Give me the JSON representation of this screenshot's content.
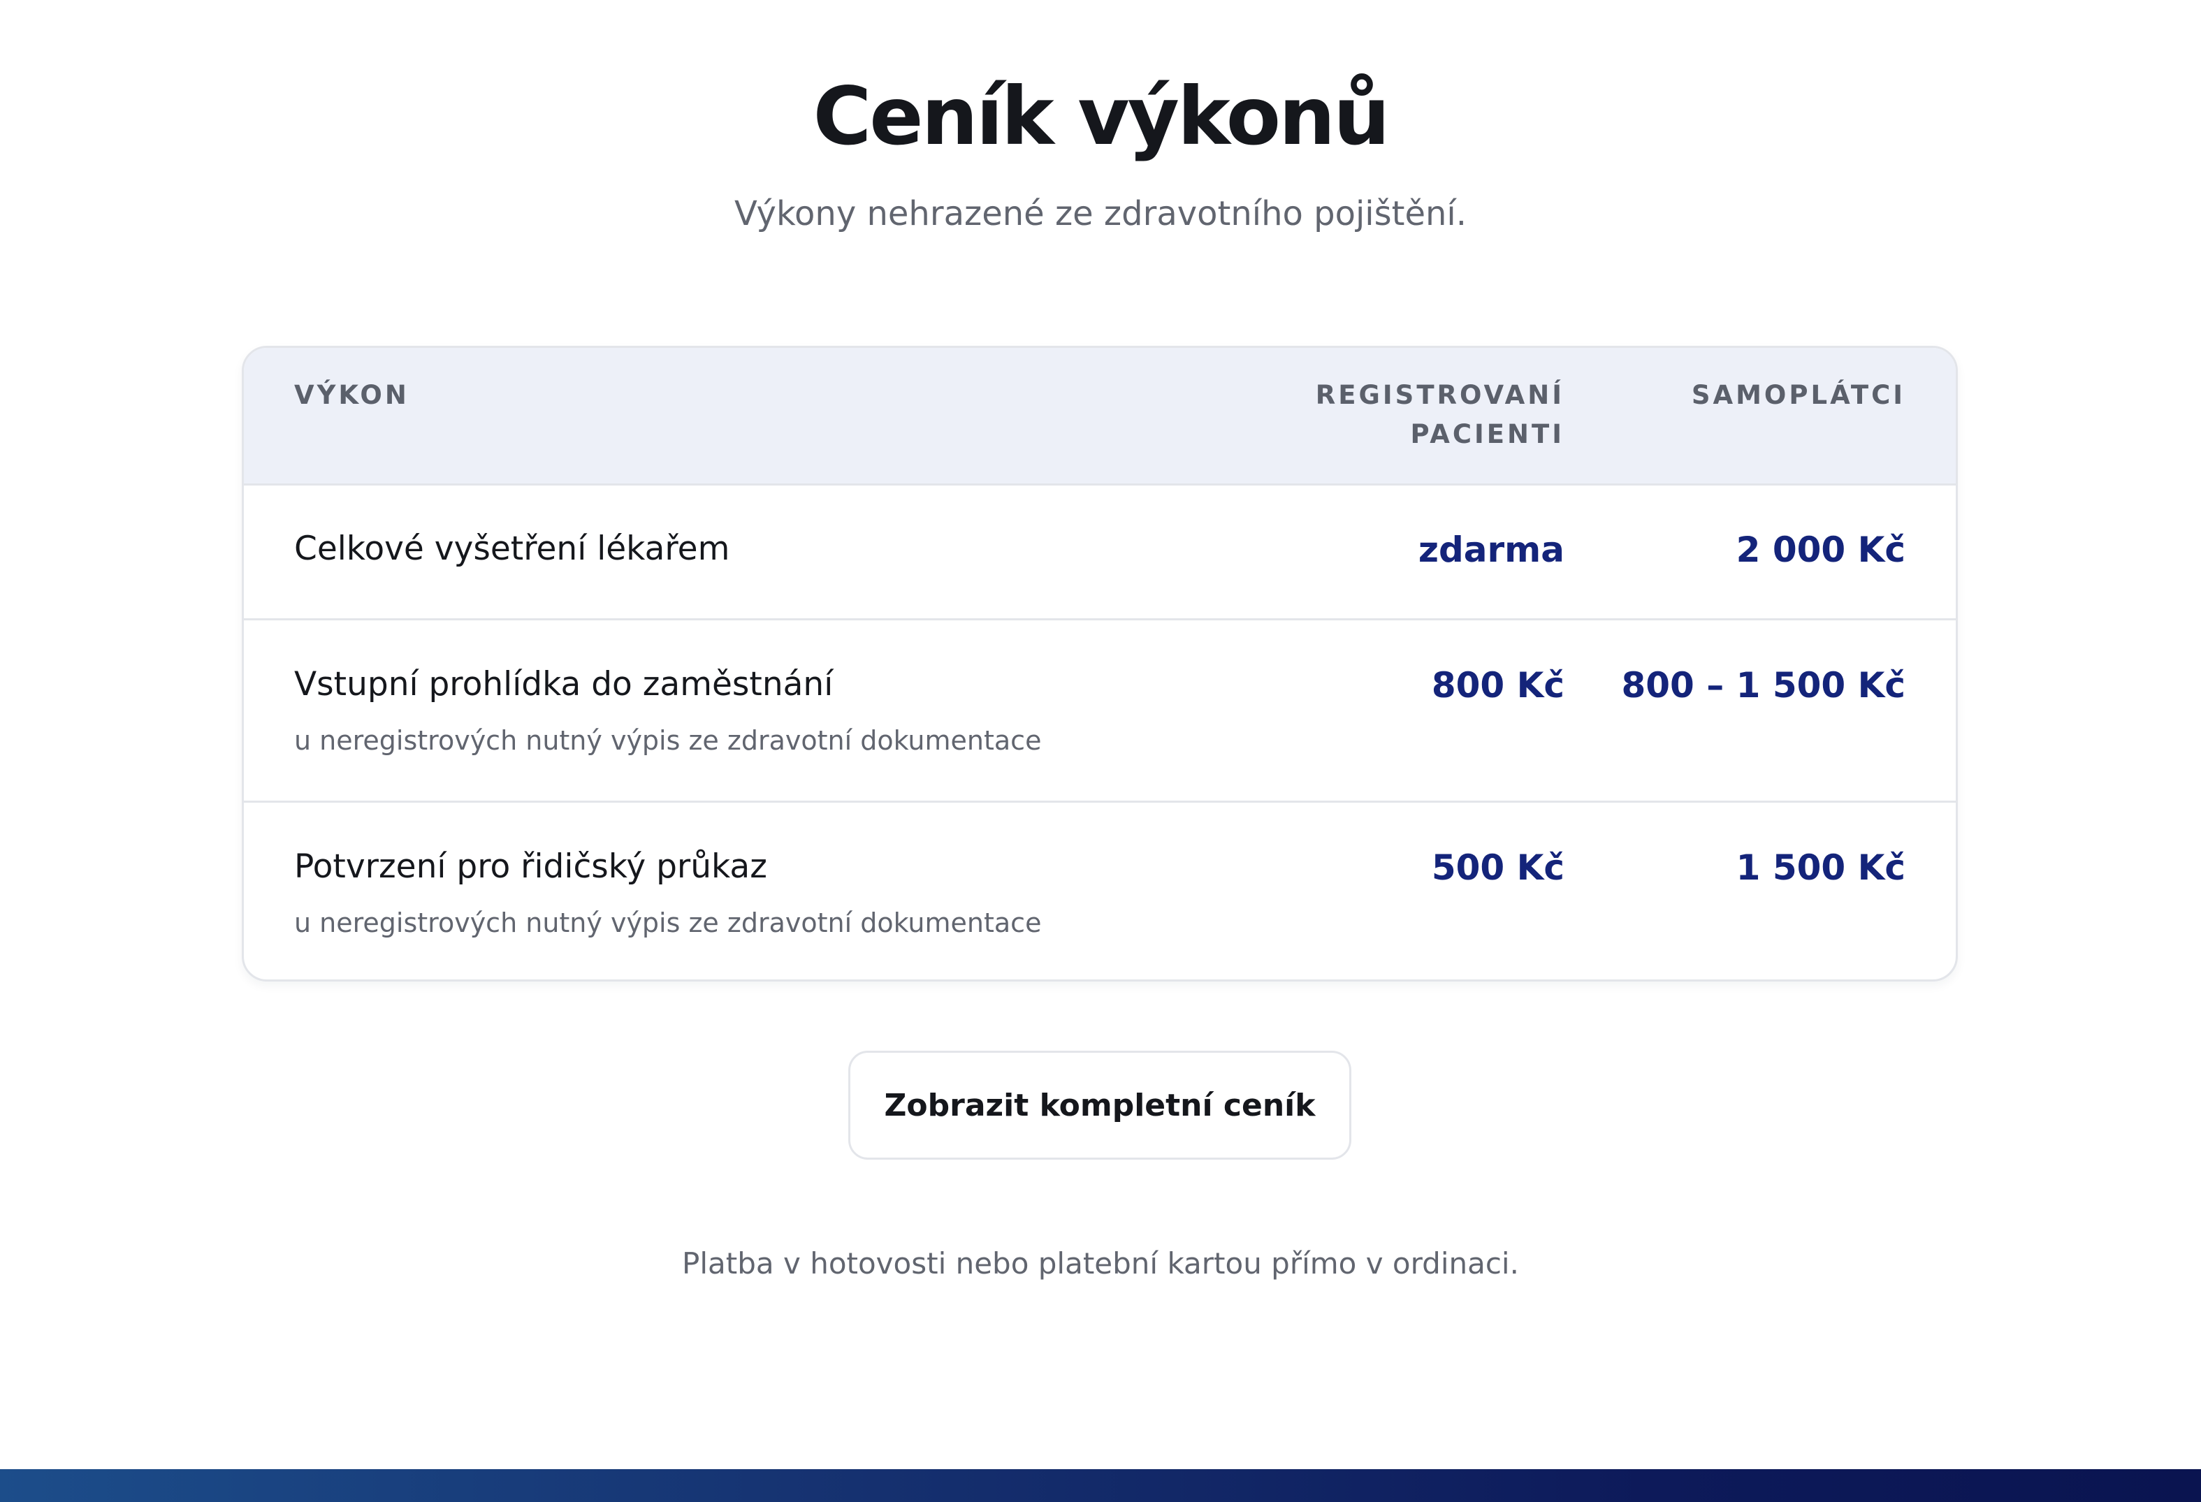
{
  "header": {
    "title": "Ceník výkonů",
    "subtitle": "Výkony nehrazené ze zdravotního pojištění."
  },
  "table": {
    "columns": {
      "service": "VÝKON",
      "registered_line1": "REGISTROVANÍ",
      "registered_line2": "PACIENTI",
      "selfpay": "SAMOPLÁTCI"
    },
    "rows": [
      {
        "name": "Celkové vyšetření lékařem",
        "note": "",
        "registered": "zdarma",
        "selfpay": "2 000 Kč"
      },
      {
        "name": "Vstupní prohlídka do zaměstnání",
        "note": "u neregistrových nutný výpis ze zdravotní dokumentace",
        "registered": "800 Kč",
        "selfpay": "800 – 1 500 Kč"
      },
      {
        "name": "Potvrzení pro řidičský průkaz",
        "note": "u neregistrových nutný výpis ze zdravotní dokumentace",
        "registered": "500 Kč",
        "selfpay": "1 500 Kč"
      }
    ]
  },
  "actions": {
    "full_pricelist_label": "Zobrazit kompletní ceník"
  },
  "footer": {
    "payment_note": "Platba v hotovosti nebo platební kartou přímo v ordinaci."
  },
  "colors": {
    "price": "#14247a",
    "header_bg": "#edf0f8",
    "footer_band_start": "#1c4d8a",
    "footer_band_end": "#0a1450"
  }
}
